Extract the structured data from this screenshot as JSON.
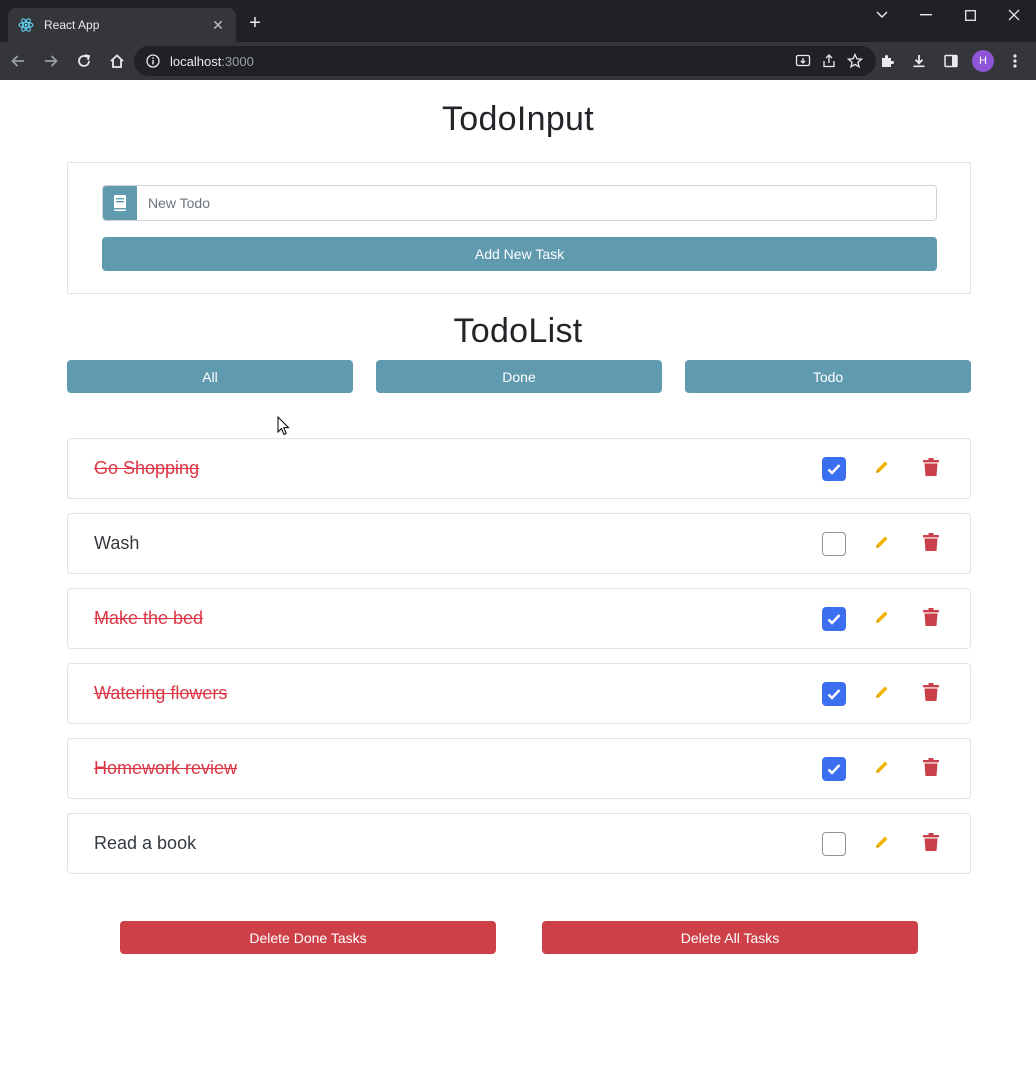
{
  "browser": {
    "tab_title": "React App",
    "tab_close": "✕",
    "new_tab": "+",
    "url_host": "localhost",
    "url_port": ":3000",
    "profile_initial": "H"
  },
  "todo_input": {
    "heading": "TodoInput",
    "placeholder": "New Todo",
    "value": "",
    "add_button": "Add New Task"
  },
  "todo_list": {
    "heading": "TodoList",
    "filters": [
      "All",
      "Done",
      "Todo"
    ],
    "items": [
      {
        "text": "Go Shopping",
        "done": true
      },
      {
        "text": "Wash",
        "done": false
      },
      {
        "text": "Make the bed",
        "done": true
      },
      {
        "text": "Watering flowers",
        "done": true
      },
      {
        "text": "Homework review",
        "done": true
      },
      {
        "text": "Read a book",
        "done": false
      }
    ]
  },
  "actions": {
    "delete_done": "Delete Done Tasks",
    "delete_all": "Delete All Tasks"
  },
  "colors": {
    "primary": "#5f9aaf",
    "danger": "#ce4048",
    "done_text": "#dc3545",
    "checkbox_checked": "#3c6ff0",
    "edit_icon": "#f0b400",
    "trash_icon": "#c9404b"
  },
  "icons": {
    "input_prefix": "book-icon",
    "edit": "pencil-icon",
    "delete": "trash-icon",
    "checked": "checkmark-icon"
  }
}
